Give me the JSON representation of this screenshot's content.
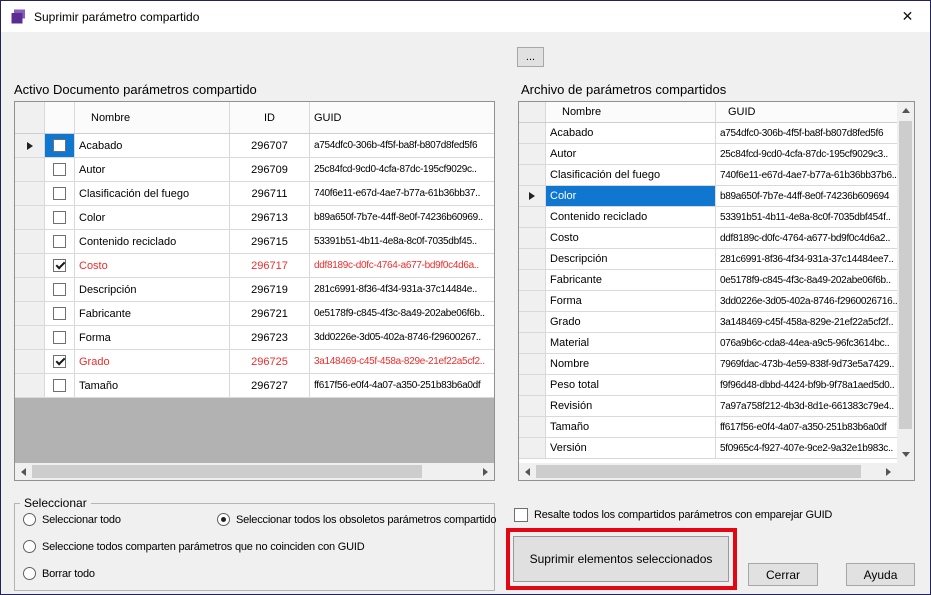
{
  "window": {
    "title": "Suprimir parámetro compartido"
  },
  "icons": {
    "close": "✕",
    "app": "purple-box-app-icon"
  },
  "browse": {
    "label": "..."
  },
  "left_grid": {
    "title": "Activo Documento parámetros compartido",
    "columns": [
      "Nombre",
      "ID",
      "GUID"
    ],
    "rows": [
      {
        "current": true,
        "checked": false,
        "checkbox_cell_selected": true,
        "red": false,
        "nombre": "Acabado",
        "id": "296707",
        "guid": "a754dfc0-306b-4f5f-ba8f-b807d8fed5f6"
      },
      {
        "current": false,
        "checked": false,
        "checkbox_cell_selected": false,
        "red": false,
        "nombre": "Autor",
        "id": "296709",
        "guid": "25c84fcd-9cd0-4cfa-87dc-195cf9029c.."
      },
      {
        "current": false,
        "checked": false,
        "checkbox_cell_selected": false,
        "red": false,
        "nombre": "Clasificación del fuego",
        "id": "296711",
        "guid": "740f6e11-e67d-4ae7-b77a-61b36bb37.."
      },
      {
        "current": false,
        "checked": false,
        "checkbox_cell_selected": false,
        "red": false,
        "nombre": "Color",
        "id": "296713",
        "guid": "b89a650f-7b7e-44ff-8e0f-74236b60969.."
      },
      {
        "current": false,
        "checked": false,
        "checkbox_cell_selected": false,
        "red": false,
        "nombre": "Contenido reciclado",
        "id": "296715",
        "guid": "53391b51-4b11-4e8a-8c0f-7035dbf45.."
      },
      {
        "current": false,
        "checked": true,
        "checkbox_cell_selected": false,
        "red": true,
        "nombre": "Costo",
        "id": "296717",
        "guid": "ddf8189c-d0fc-4764-a677-bd9f0c4d6a.."
      },
      {
        "current": false,
        "checked": false,
        "checkbox_cell_selected": false,
        "red": false,
        "nombre": "Descripción",
        "id": "296719",
        "guid": "281c6991-8f36-4f34-931a-37c14484e.."
      },
      {
        "current": false,
        "checked": false,
        "checkbox_cell_selected": false,
        "red": false,
        "nombre": "Fabricante",
        "id": "296721",
        "guid": "0e5178f9-c845-4f3c-8a49-202abe06f6b.."
      },
      {
        "current": false,
        "checked": false,
        "checkbox_cell_selected": false,
        "red": false,
        "nombre": "Forma",
        "id": "296723",
        "guid": "3dd0226e-3d05-402a-8746-f29600267.."
      },
      {
        "current": false,
        "checked": true,
        "checkbox_cell_selected": false,
        "red": true,
        "nombre": "Grado",
        "id": "296725",
        "guid": "3a148469-c45f-458a-829e-21ef22a5cf2.."
      },
      {
        "current": false,
        "checked": false,
        "checkbox_cell_selected": false,
        "red": false,
        "nombre": "Tamaño",
        "id": "296727",
        "guid": "ff617f56-e0f4-4a07-a350-251b83b6a0df"
      }
    ]
  },
  "right_grid": {
    "title": "Archivo de parámetros compartidos",
    "columns": [
      "Nombre",
      "GUID"
    ],
    "rows": [
      {
        "current": false,
        "selected": false,
        "nombre": "Acabado",
        "guid": "a754dfc0-306b-4f5f-ba8f-b807d8fed5f6"
      },
      {
        "current": false,
        "selected": false,
        "nombre": "Autor",
        "guid": "25c84fcd-9cd0-4cfa-87dc-195cf9029c3.."
      },
      {
        "current": false,
        "selected": false,
        "nombre": "Clasificación del fuego",
        "guid": "740f6e11-e67d-4ae7-b77a-61b36bb37b6.."
      },
      {
        "current": true,
        "selected": true,
        "nombre": "Color",
        "guid": "b89a650f-7b7e-44ff-8e0f-74236b609694"
      },
      {
        "current": false,
        "selected": false,
        "nombre": "Contenido reciclado",
        "guid": "53391b51-4b11-4e8a-8c0f-7035dbf454f.."
      },
      {
        "current": false,
        "selected": false,
        "nombre": "Costo",
        "guid": "ddf8189c-d0fc-4764-a677-bd9f0c4d6a2.."
      },
      {
        "current": false,
        "selected": false,
        "nombre": "Descripción",
        "guid": "281c6991-8f36-4f34-931a-37c14484ee7.."
      },
      {
        "current": false,
        "selected": false,
        "nombre": "Fabricante",
        "guid": "0e5178f9-c845-4f3c-8a49-202abe06f6b.."
      },
      {
        "current": false,
        "selected": false,
        "nombre": "Forma",
        "guid": "3dd0226e-3d05-402a-8746-f2960026716.."
      },
      {
        "current": false,
        "selected": false,
        "nombre": "Grado",
        "guid": "3a148469-c45f-458a-829e-21ef22a5cf2f.."
      },
      {
        "current": false,
        "selected": false,
        "nombre": "Material",
        "guid": "076a9b6c-cda8-44ea-a9c5-96fc3614bc.."
      },
      {
        "current": false,
        "selected": false,
        "nombre": "Nombre",
        "guid": "7969fdac-473b-4e59-838f-9d73e5a7429.."
      },
      {
        "current": false,
        "selected": false,
        "nombre": "Peso total",
        "guid": "f9f96d48-dbbd-4424-bf9b-9f78a1aed5d0.."
      },
      {
        "current": false,
        "selected": false,
        "nombre": "Revisión",
        "guid": "7a97a758f212-4b3d-8d1e-661383c79e4.."
      },
      {
        "current": false,
        "selected": false,
        "nombre": "Tamaño",
        "guid": "ff617f56-e0f4-4a07-a350-251b83b6a0df"
      },
      {
        "current": false,
        "selected": false,
        "nombre": "Versión",
        "guid": "5f0965c4-f927-407e-9ce2-9a32e1b983c.."
      }
    ]
  },
  "select_group": {
    "title": "Seleccionar",
    "options": [
      {
        "label": "Seleccionar todo",
        "selected": false
      },
      {
        "label": "Seleccionar todos los obsoletos parámetros compartido",
        "selected": true
      },
      {
        "label": "Seleccione todos comparten parámetros que no coinciden con GUID",
        "selected": false
      },
      {
        "label": "Borrar todo",
        "selected": false
      }
    ]
  },
  "highlight_checkbox": {
    "label": "Resalte todos los compartidos parámetros con emparejar GUID",
    "checked": false
  },
  "buttons": {
    "delete": "Suprimir elementos seleccionados",
    "close": "Cerrar",
    "help": "Ayuda"
  },
  "colors": {
    "selection": "#0f77d0",
    "obsolete_red": "#ee2c2c",
    "annotation": "#e30613"
  }
}
